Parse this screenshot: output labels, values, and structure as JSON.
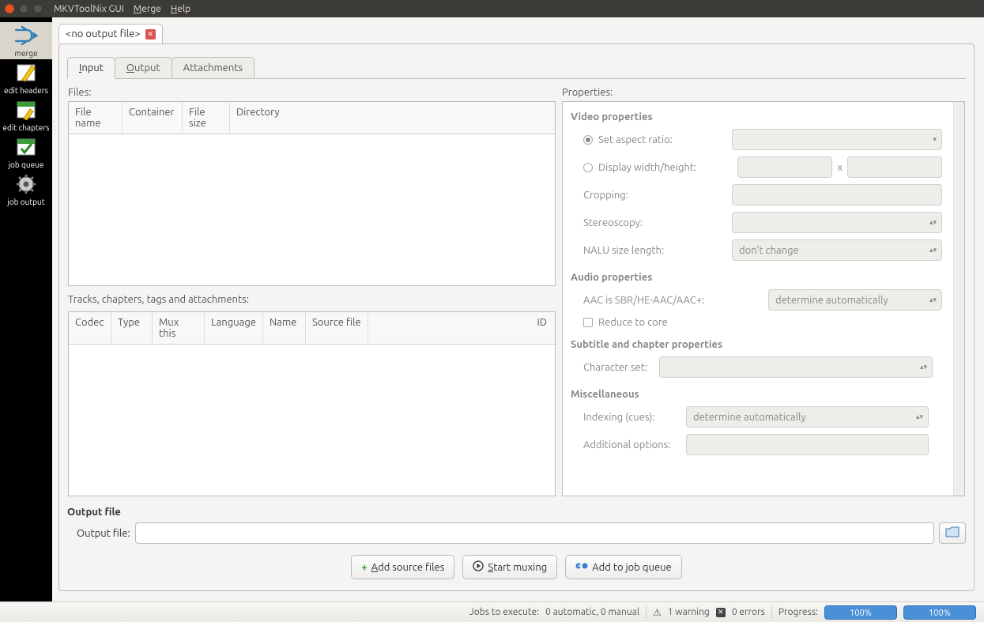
{
  "titlebar": {
    "app_name": "MKVToolNix GUI",
    "merge_menu": "Merge",
    "help_menu": "Help"
  },
  "sidebar": [
    {
      "label": "merge",
      "icon": "merge"
    },
    {
      "label": "edit headers",
      "icon": "pencil"
    },
    {
      "label": "edit chapters",
      "icon": "chapters"
    },
    {
      "label": "job queue",
      "icon": "check"
    },
    {
      "label": "job output",
      "icon": "gear"
    }
  ],
  "file_tab_label": "<no output file>",
  "inner_tabs": {
    "input": "Input",
    "output": "Output",
    "attachments": "Attachments"
  },
  "files": {
    "label": "Files:",
    "columns": [
      "File name",
      "Container",
      "File size",
      "Directory"
    ]
  },
  "tracks": {
    "label": "Tracks, chapters, tags and attachments:",
    "columns": [
      "Codec",
      "Type",
      "Mux this",
      "Language",
      "Name",
      "Source file",
      "ID"
    ]
  },
  "properties": {
    "label": "Properties:",
    "video_group": "Video properties",
    "set_aspect_ratio": "Set aspect ratio:",
    "display_wh": "Display width/height:",
    "x_sep": "x",
    "cropping": "Cropping:",
    "stereoscopy": "Stereoscopy:",
    "nalu": "NALU size length:",
    "nalu_value": "don't change",
    "audio_group": "Audio properties",
    "aac": "AAC is SBR/HE-AAC/AAC+:",
    "aac_value": "determine automatically",
    "reduce_core": "Reduce to core",
    "subchap_group": "Subtitle and chapter properties",
    "charset": "Character set:",
    "misc_group": "Miscellaneous",
    "indexing": "Indexing (cues):",
    "indexing_value": "determine automatically",
    "addl_opts": "Additional options:"
  },
  "output": {
    "section": "Output file",
    "label": "Output file:"
  },
  "actions": {
    "add_source": "Add source files",
    "start_mux": "Start muxing",
    "add_queue": "Add to job queue"
  },
  "status": {
    "jobs": "Jobs to execute:",
    "jobs_val": "0 automatic, 0 manual",
    "warnings": "1 warning",
    "errors": "0 errors",
    "progress_lbl": "Progress:",
    "progress_val": "100%"
  }
}
